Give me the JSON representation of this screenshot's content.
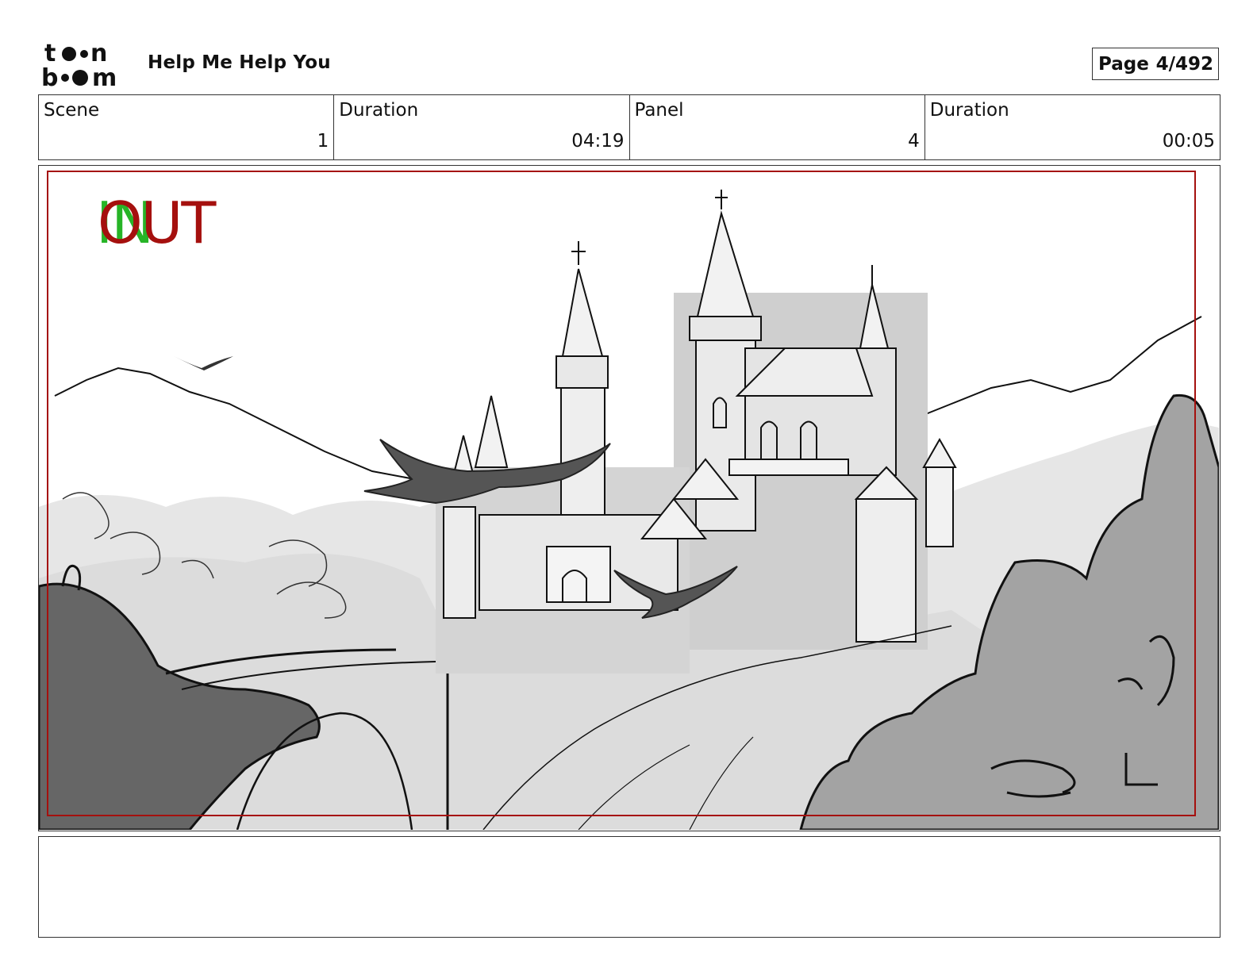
{
  "header": {
    "logo_text": "toon boom",
    "project_title": "Help Me Help You",
    "page_label": "Page",
    "page_value": "4/492"
  },
  "info": [
    {
      "label": "Scene",
      "value": "1"
    },
    {
      "label": "Duration",
      "value": "04:19"
    },
    {
      "label": "Panel",
      "value": "4"
    },
    {
      "label": "Duration",
      "value": "00:05"
    }
  ],
  "panel": {
    "in_marker": "IN",
    "out_marker": "OUT",
    "safe_frame_color": "#a5100e",
    "in_color": "#27b427",
    "out_color": "#a5100e"
  },
  "notes": {
    "text": ""
  }
}
